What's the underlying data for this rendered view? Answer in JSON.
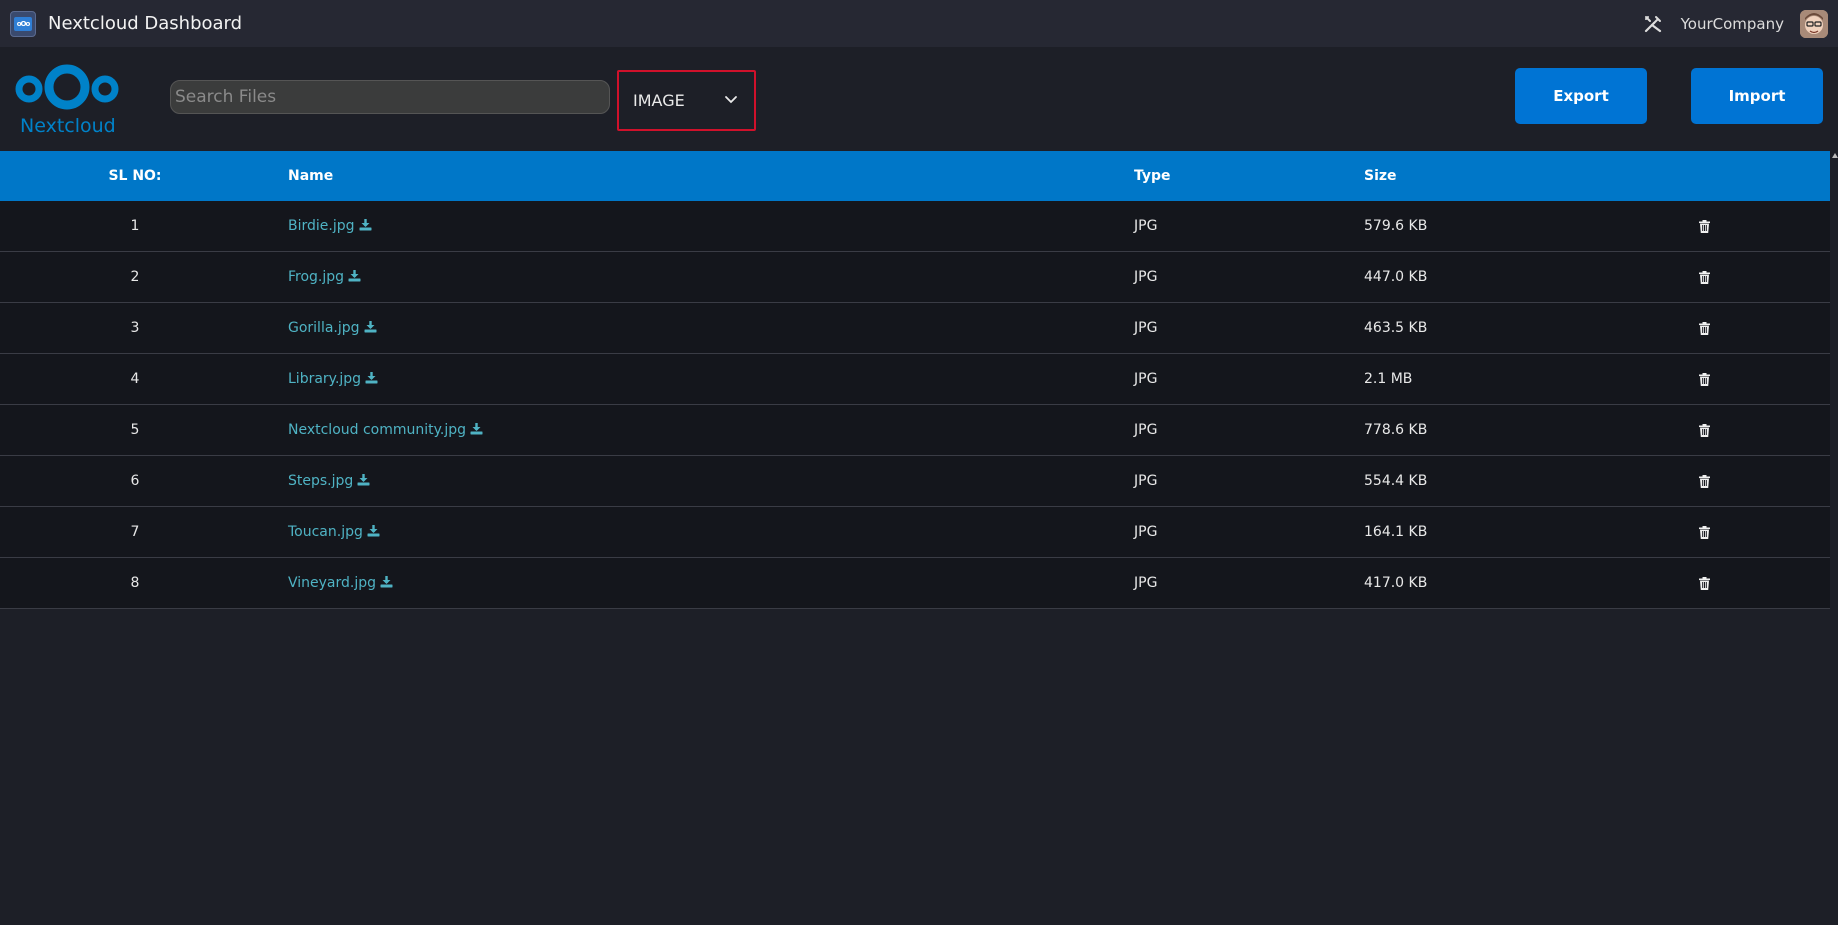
{
  "window": {
    "title": "Nextcloud Dashboard",
    "company": "YourCompany"
  },
  "logo": {
    "text": "Nextcloud"
  },
  "search": {
    "placeholder": "Search Files",
    "value": ""
  },
  "filter": {
    "selected": "IMAGE"
  },
  "actions": {
    "export_label": "Export",
    "import_label": "Import"
  },
  "table": {
    "headers": {
      "sl": "SL NO:",
      "name": "Name",
      "type": "Type",
      "size": "Size"
    },
    "rows": [
      {
        "sl": "1",
        "name": "Birdie.jpg",
        "type": "JPG",
        "size": "579.6 KB"
      },
      {
        "sl": "2",
        "name": "Frog.jpg",
        "type": "JPG",
        "size": "447.0 KB"
      },
      {
        "sl": "3",
        "name": "Gorilla.jpg",
        "type": "JPG",
        "size": "463.5 KB"
      },
      {
        "sl": "4",
        "name": "Library.jpg",
        "type": "JPG",
        "size": "2.1 MB"
      },
      {
        "sl": "5",
        "name": "Nextcloud community.jpg",
        "type": "JPG",
        "size": "778.6 KB"
      },
      {
        "sl": "6",
        "name": "Steps.jpg",
        "type": "JPG",
        "size": "554.4 KB"
      },
      {
        "sl": "7",
        "name": "Toucan.jpg",
        "type": "JPG",
        "size": "164.1 KB"
      },
      {
        "sl": "8",
        "name": "Vineyard.jpg",
        "type": "JPG",
        "size": "417.0 KB"
      }
    ]
  },
  "colors": {
    "accent": "#0077c8",
    "link": "#4fb3c4",
    "highlight_border": "#d0112b"
  },
  "icons": {
    "download": "download-icon",
    "delete": "trash-icon",
    "tools": "tools-icon",
    "chevron": "chevron-down-icon"
  }
}
